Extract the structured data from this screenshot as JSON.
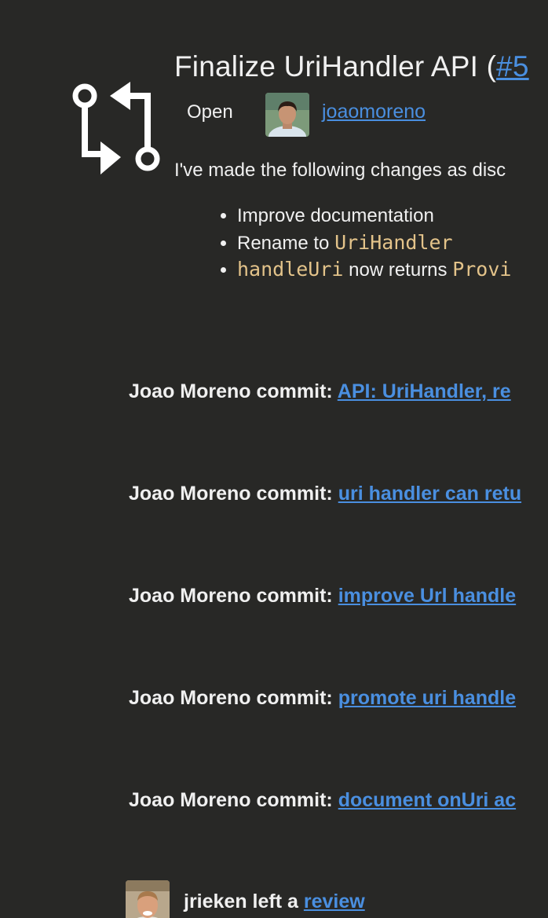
{
  "pr": {
    "title_prefix": "Finalize UriHandler API (",
    "issue_ref": "#5",
    "status": "Open",
    "author": "joaomoreno",
    "description": "I've made the following changes as disc",
    "changes": [
      {
        "text": "Improve documentation",
        "code": "",
        "suffix": ""
      },
      {
        "text": "Rename to ",
        "code": "UriHandler",
        "suffix": ""
      },
      {
        "text": "",
        "code": "handleUri",
        "suffix": " now returns ",
        "code2": "Provi"
      }
    ]
  },
  "commits": [
    {
      "author": "Joao Moreno commit:",
      "message": "API: UriHandler, re"
    },
    {
      "author": "Joao Moreno commit:",
      "message": "uri handler can retu"
    },
    {
      "author": "Joao Moreno commit:",
      "message": "improve Url handle"
    },
    {
      "author": "Joao Moreno commit:",
      "message": "promote uri handle"
    },
    {
      "author": "Joao Moreno commit:",
      "message": "document onUri ac"
    }
  ],
  "review": {
    "user": "jrieken",
    "action": " left a ",
    "link": "review"
  },
  "colors": {
    "background": "#282826",
    "link": "#4a8fe0",
    "code": "#e3c38a",
    "text": "#f0f0f0"
  },
  "icons": {
    "pr_icon": "git-pull-request-icon"
  }
}
